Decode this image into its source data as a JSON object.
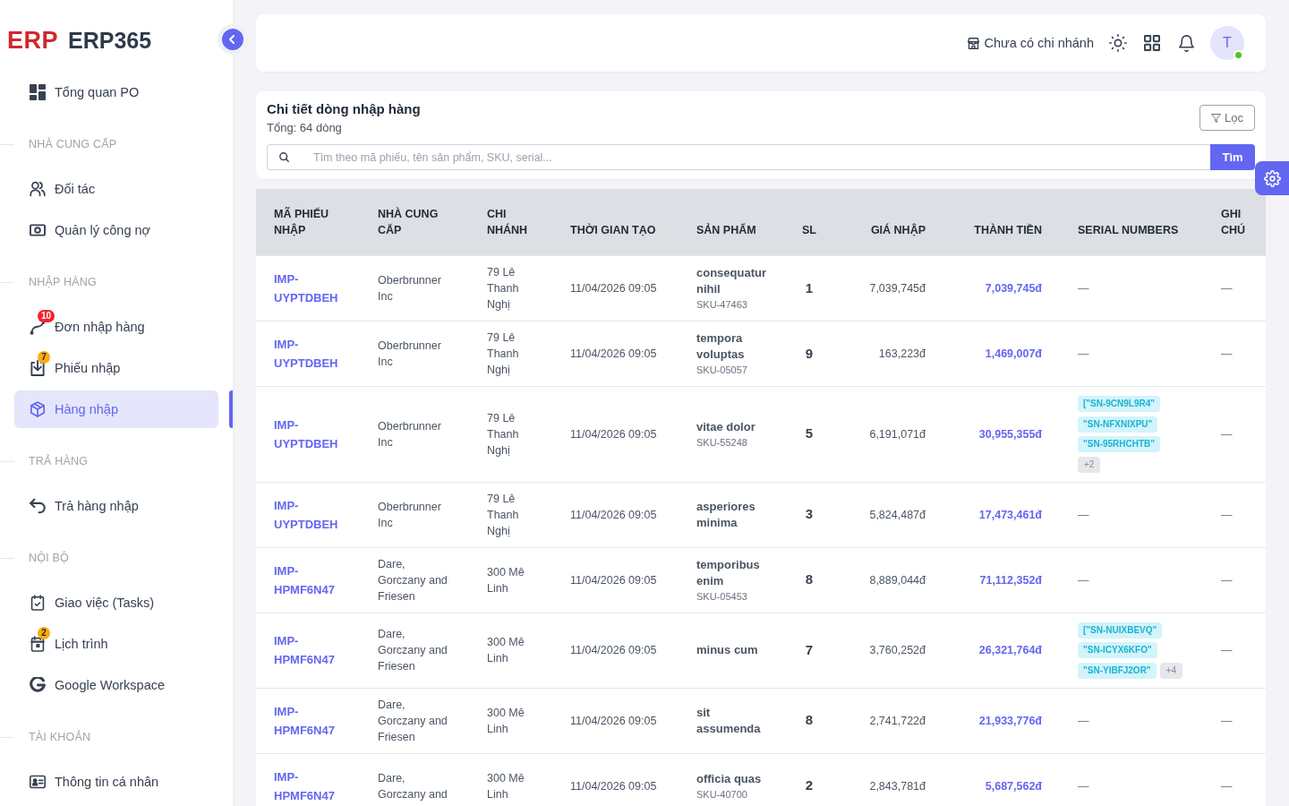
{
  "sidebar": {
    "logo_mark": "ERP",
    "app_name": "ERP365",
    "sections": [
      {
        "items": [
          {
            "label": "Tổng quan PO",
            "selected": false
          }
        ]
      },
      {
        "title": "NHÀ CUNG CẤP",
        "items": [
          {
            "label": "Đối tác",
            "selected": false
          },
          {
            "label": "Quản lý công nợ",
            "selected": false
          }
        ]
      },
      {
        "title": "NHẬP HÀNG",
        "items": [
          {
            "label": "Đơn nhập hàng",
            "selected": false,
            "badge": {
              "text": "10",
              "color": "#f5222d"
            }
          },
          {
            "label": "Phiếu nhập",
            "selected": false,
            "badge": {
              "text": "7",
              "color": "#faad14"
            }
          },
          {
            "label": "Hàng nhập",
            "selected": true
          }
        ]
      },
      {
        "title": "TRẢ HÀNG",
        "items": [
          {
            "label": "Trả hàng nhập",
            "selected": false
          }
        ]
      },
      {
        "title": "NỘI BỘ",
        "items": [
          {
            "label": "Giao việc (Tasks)",
            "selected": false
          },
          {
            "label": "Lịch trình",
            "selected": false,
            "badge": {
              "text": "2",
              "color": "#faad14"
            }
          },
          {
            "label": "Google Workspace",
            "selected": false
          }
        ]
      },
      {
        "title": "TÀI KHOẢN",
        "items": [
          {
            "label": "Thông tin cá nhân",
            "selected": false
          }
        ]
      }
    ]
  },
  "topbar": {
    "branch": "Chưa có chi nhánh",
    "avatar": {
      "initial": "T",
      "online": true
    }
  },
  "panel": {
    "title": "Chi tiết dòng nhập hàng",
    "subtitle": "Tổng: 64 dòng",
    "filter_button": "Lọc",
    "search": {
      "placeholder": "Tìm theo mã phiếu, tên sản phẩm, SKU, serial...",
      "button": "Tìm"
    }
  },
  "table": {
    "columns": [
      "MÃ PHIẾU NHẬP",
      "NHÀ CUNG CẤP",
      "CHI NHÁNH",
      "THỜI GIAN TẠO",
      "SẢN PHẨM",
      "SL",
      "GIÁ NHẬP",
      "THÀNH TIỀN",
      "SERIAL NUMBERS",
      "GHI CHÚ"
    ],
    "rows": [
      {
        "code": "IMP-UYPTDBEH",
        "supplier": "Oberbrunner Inc",
        "branch": "79 Lê Thanh Nghị",
        "created": "11/04/2026 09:05",
        "product": "consequatur nihil",
        "sku": "SKU-47463",
        "qty": "1",
        "unit_price": "7,039,745đ",
        "amount": "7,039,745đ",
        "serials": "—",
        "note": "—"
      },
      {
        "code": "IMP-UYPTDBEH",
        "supplier": "Oberbrunner Inc",
        "branch": "79 Lê Thanh Nghị",
        "created": "11/04/2026 09:05",
        "product": "tempora voluptas",
        "sku": "SKU-05057",
        "qty": "9",
        "unit_price": "163,223đ",
        "amount": "1,469,007đ",
        "serials": "—",
        "note": "—"
      },
      {
        "code": "IMP-UYPTDBEH",
        "supplier": "Oberbrunner Inc",
        "branch": "79 Lê Thanh Nghị",
        "created": "11/04/2026 09:05",
        "product": "vitae dolor",
        "sku": "SKU-55248",
        "qty": "5",
        "unit_price": "6,191,071đ",
        "amount": "30,955,355đ",
        "serials": [
          "[\"SN-9CN9L9R4\"",
          "\"SN-NFXNIXPU\"",
          "\"SN-95RHCHTB\""
        ],
        "serials_more": "+2",
        "note": "—"
      },
      {
        "code": "IMP-UYPTDBEH",
        "supplier": "Oberbrunner Inc",
        "branch": "79 Lê Thanh Nghị",
        "created": "11/04/2026 09:05",
        "product": "asperiores minima",
        "qty": "3",
        "unit_price": "5,824,487đ",
        "amount": "17,473,461đ",
        "serials": "—",
        "note": "—"
      },
      {
        "code": "IMP-HPMF6N47",
        "supplier": "Dare, Gorczany and Friesen",
        "branch": "300 Mê Linh",
        "created": "11/04/2026 09:05",
        "product": "temporibus enim",
        "sku": "SKU-05453",
        "qty": "8",
        "unit_price": "8,889,044đ",
        "amount": "71,112,352đ",
        "serials": "—",
        "note": "—"
      },
      {
        "code": "IMP-HPMF6N47",
        "supplier": "Dare, Gorczany and Friesen",
        "branch": "300 Mê Linh",
        "created": "11/04/2026 09:05",
        "product": "minus cum",
        "qty": "7",
        "unit_price": "3,760,252đ",
        "amount": "26,321,764đ",
        "serials": [
          "[\"SN-NUIXBEVQ\"",
          "\"SN-ICYX6KFO\"",
          "\"SN-YIBFJ2OR\""
        ],
        "serials_more": "+4",
        "note": "—"
      },
      {
        "code": "IMP-HPMF6N47",
        "supplier": "Dare, Gorczany and Friesen",
        "branch": "300 Mê Linh",
        "created": "11/04/2026 09:05",
        "product": "sit assumenda",
        "qty": "8",
        "unit_price": "2,741,722đ",
        "amount": "21,933,776đ",
        "serials": "—",
        "note": "—"
      },
      {
        "code": "IMP-HPMF6N47",
        "supplier": "Dare, Gorczany and",
        "branch": "300 Mê Linh",
        "created": "11/04/2026 09:05",
        "product": "officia quas",
        "sku": "SKU-40700",
        "qty": "2",
        "unit_price": "2,843,781đ",
        "amount": "5,687,562đ",
        "serials": "—",
        "note": "—"
      }
    ]
  }
}
